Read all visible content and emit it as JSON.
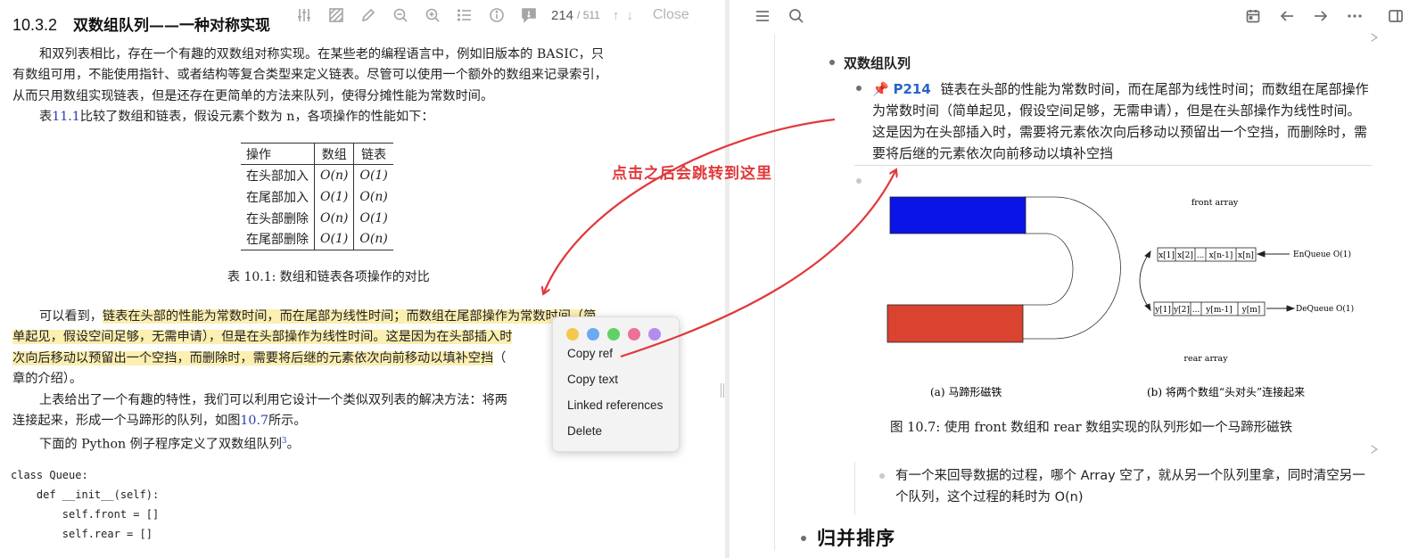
{
  "pdf": {
    "toolbar": {
      "icons": [
        "sliders-icon",
        "hatch-icon",
        "pencil-icon",
        "zoom-out-icon",
        "zoom-in-icon",
        "list-icon",
        "info-icon",
        "comment-icon"
      ],
      "page_current": "214",
      "page_total": "/ 511",
      "up_arrow": "↑",
      "down_arrow": "↓",
      "close_label": "Close"
    },
    "section_number": "10.3.2",
    "section_title": "双数组队列——一种对称实现",
    "para1_l1": "和双列表相比，存在一个有趣的双数组对称实现。在某些老的编程语言中，例如旧版本的 BASIC，只",
    "para1_l2": "有数组可用，不能使用指针、或者结构等复合类型来定义链表。尽管可以使用一个额外的数组来记录索引，",
    "para1_l3": "从而只用数组实现链表，但是还存在更简单的方法来队列，使得分摊性能为常数时间。",
    "para2_pre": "表",
    "para2_ref": "11.1",
    "para2_post": "比较了数组和链表，假设元素个数为 n，各项操作的性能如下：",
    "table": {
      "headers": [
        "操作",
        "数组",
        "链表"
      ],
      "rows": [
        [
          "在头部加入",
          "O(n)",
          "O(1)"
        ],
        [
          "在尾部加入",
          "O(1)",
          "O(n)"
        ],
        [
          "在头部删除",
          "O(n)",
          "O(1)"
        ],
        [
          "在尾部删除",
          "O(1)",
          "O(n)"
        ]
      ],
      "caption": "表 10.1: 数组和链表各项操作的对比"
    },
    "para3_pre": "可以看到，",
    "para3_hl1": "链表在头部的性能为常数时间，而在尾部为线性时间；而数组在尾部操作为常数时间（简",
    "para3_hl2": "单起见，假设空间足够，无需申请），但是在头部操作为线性时间。这是因为在头部插入时",
    "para3_hl3": "次向后移动以预留出一个空挡，而删除时，需要将后继的元素依次向前移动以填补空挡",
    "para3_tail": "（",
    "para3_l4": "章的介绍）。",
    "para4_l1": "上表给出了一个有趣的特性，我们可以利用它设计一个类似双列表的解决方法：将两",
    "para4_l2_pre": "连接起来，形成一个马蹄形的队列，如图",
    "para4_l2_ref": "10.7",
    "para4_l2_post": "所示。",
    "para5_pre": "下面的 Python 例子程序定义了双数组队列",
    "para5_sup": "3",
    "para5_post": "。",
    "code_lines": [
      "class Queue:",
      "    def __init__(self):",
      "        self.front = []",
      "        self.rear = []"
    ]
  },
  "context_menu": {
    "colors": [
      "#f2c94c",
      "#6aaaf5",
      "#5fd167",
      "#ee7096",
      "#b48cf0"
    ],
    "items": [
      "Copy ref",
      "Copy text",
      "Linked references",
      "Delete"
    ]
  },
  "annotation": {
    "text": "点击之后会跳转到这里",
    "color": "#e0393b"
  },
  "notes": {
    "nav_icons": [
      "menu-icon",
      "search-icon",
      "calendar-icon",
      "back-arrow-icon",
      "forward-arrow-icon",
      "more-icon"
    ],
    "heading_queue": "双数组队列",
    "ref_pin": "📌",
    "ref_page": "P214",
    "ref_text": "链表在头部的性能为常数时间，而在尾部为线性时间；而数组在尾部操作为常数时间（简单起见，假设空间足够，无需申请），但是在头部操作为线性时间。这是因为在头部插入时，需要将元素依次向后移动以预留出一个空挡，而删除时，需要将后继的元素依次向前移动以填补空挡",
    "figure": {
      "front_label": "front array",
      "rear_label": "rear array",
      "front_cells": [
        "x[1]",
        "x[2]",
        "...",
        "x[n-1]",
        "x[n]"
      ],
      "rear_cells": [
        "y[1]",
        "y[2]",
        "...",
        "y[m-1]",
        "y[m]"
      ],
      "enqueue": "EnQueue O(1)",
      "dequeue": "DeQueue O(1)",
      "sub_a": "(a) 马蹄形磁铁",
      "sub_b": "(b) 将两个数组“头对头”连接起来",
      "blue": "#0a14e6",
      "red": "#d9432f"
    },
    "fig_caption": "图 10.7: 使用 front 数组和 rear 数组实现的队列形如一个马蹄形磁铁",
    "note_text": "有一个来回导数据的过程，哪个 Array 空了，就从另一个队列里拿，同时清空另一个队列，这个过程的耗时为 O(n)",
    "heading_merge": "归并排序"
  }
}
